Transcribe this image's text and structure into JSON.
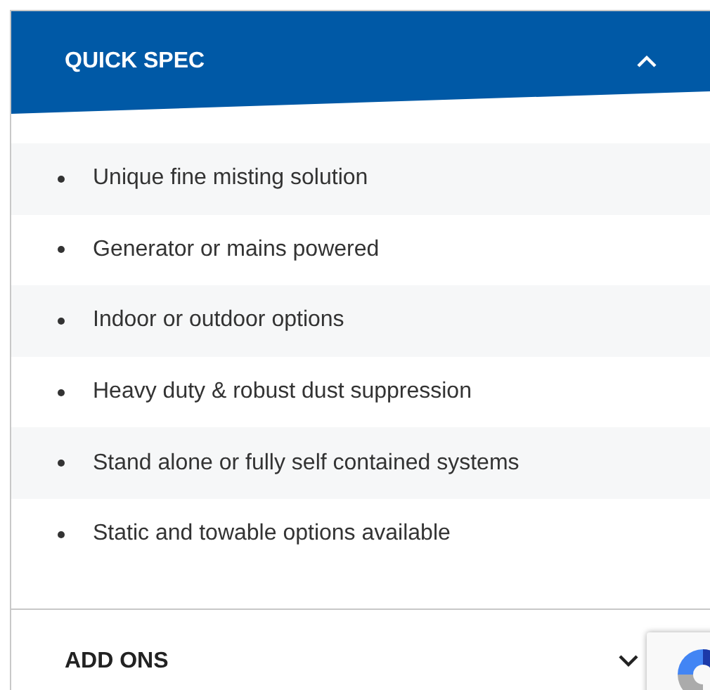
{
  "sections": [
    {
      "title": "QUICK SPEC",
      "expanded": true,
      "items": [
        "Unique fine misting solution",
        "Generator or mains powered",
        "Indoor or outdoor options",
        "Heavy duty & robust dust suppression",
        "Stand alone or fully self contained systems",
        "Static and towable options available"
      ]
    },
    {
      "title": "ADD ONS",
      "expanded": false
    }
  ]
}
